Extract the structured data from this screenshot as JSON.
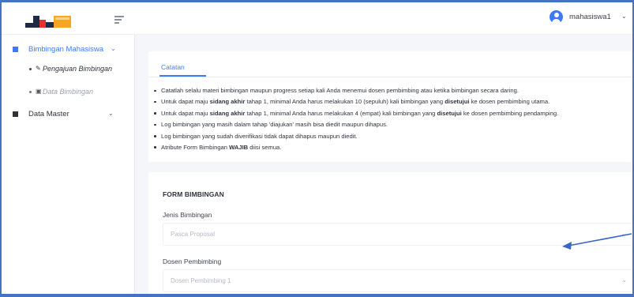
{
  "user": {
    "name": "mahasiswa1",
    "caret": "⌄"
  },
  "sidebar": {
    "menu_toggle": "menu-toggle",
    "items": [
      {
        "label": "Bimbingan Mahasiswa",
        "caret": "⌄",
        "color": "#3f7af6",
        "children": [
          {
            "label": "Pengajuan Bimbingan",
            "icon": "✎"
          },
          {
            "label": "Data Bimbingan",
            "icon": "▣"
          }
        ]
      },
      {
        "label": "Data Master",
        "caret": "⌄",
        "color": "#333333"
      }
    ]
  },
  "notes": {
    "tab_label": "Catatan",
    "items": [
      {
        "segments": [
          {
            "t": "Catatlah selalu materi bimbingan maupun progress setiap kali Anda menemui dosen pembimbing atau ketika bimbingan secara daring."
          }
        ]
      },
      {
        "segments": [
          {
            "t": "Untuk dapat maju "
          },
          {
            "t": "sidang akhir",
            "b": true
          },
          {
            "t": " tahap 1, minimal Anda harus melakukan 10 (sepuluh) kali bimbingan yang "
          },
          {
            "t": "disetujui",
            "b": true
          },
          {
            "t": " ke dosen pembimbing utama."
          }
        ]
      },
      {
        "segments": [
          {
            "t": "Untuk dapat maju "
          },
          {
            "t": "sidang akhir",
            "b": true
          },
          {
            "t": " tahap 1, minimal Anda harus melakukan 4 (empat) kali bimbingan yang "
          },
          {
            "t": "disetujui",
            "b": true
          },
          {
            "t": " ke dosen pembimbing pendamping."
          }
        ]
      },
      {
        "segments": [
          {
            "t": "Log bimbingan yang masih dalam tahap 'diajukan' masih bisa diedit maupun dihapus."
          }
        ]
      },
      {
        "segments": [
          {
            "t": "Log bimbingan yang sudah diverifikasi tidak dapat dihapus maupun diedit."
          }
        ]
      },
      {
        "segments": [
          {
            "t": "Atribute Form Bimbingan "
          },
          {
            "t": "WAJIB",
            "b": true
          },
          {
            "t": " diisi semua."
          }
        ]
      }
    ]
  },
  "form": {
    "title": "FORM BIMBINGAN",
    "fields": [
      {
        "label": "Jenis Bimbingan",
        "value": "Pasca Proposal"
      },
      {
        "label": "Dosen Pembimbing",
        "value": "Dosen Pembimbing 1"
      }
    ],
    "caret": "⌄"
  },
  "colors": {
    "accent": "#3f7af6",
    "frame_border": "#4472c4",
    "annotation_arrow": "#3a66c2",
    "logo": [
      "#1f2a44",
      "#f5a623",
      "#e8312e"
    ]
  }
}
